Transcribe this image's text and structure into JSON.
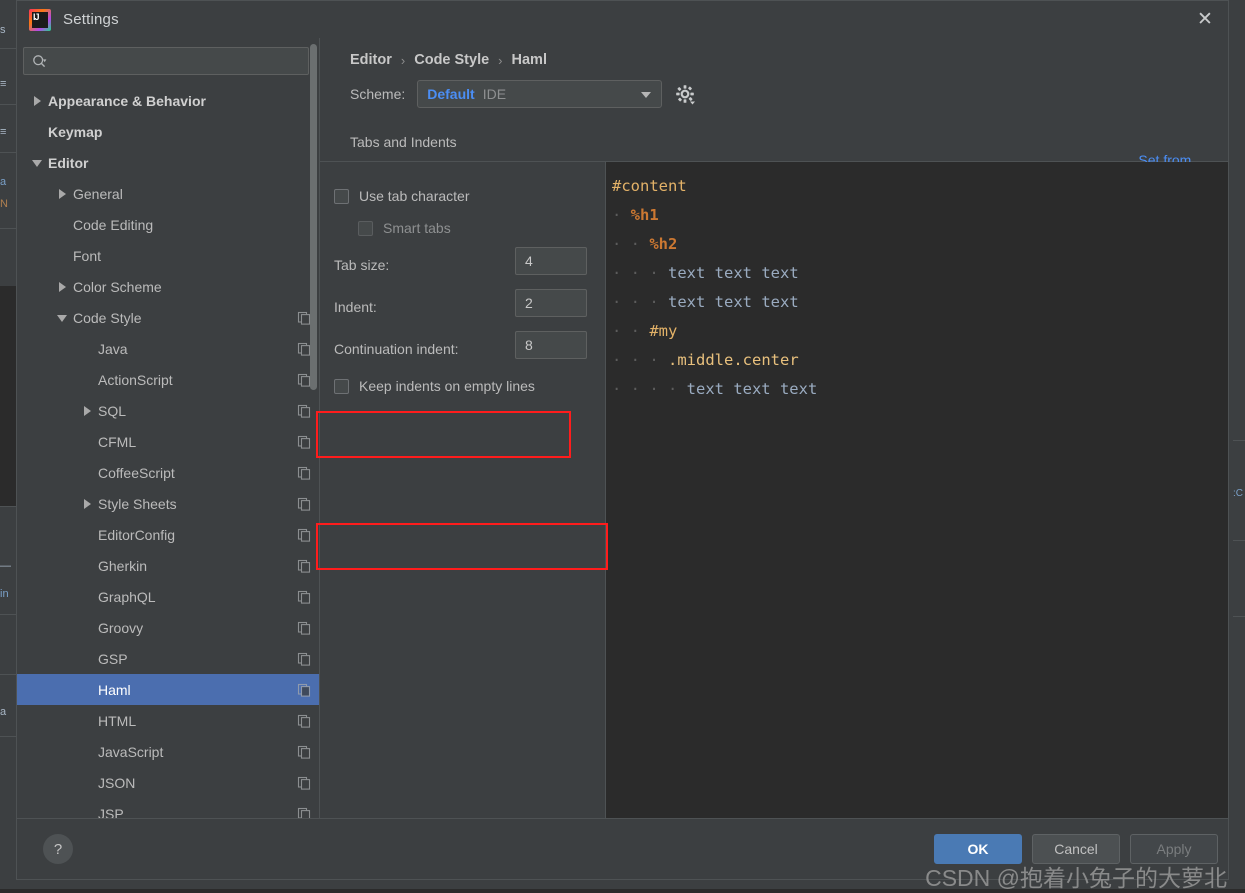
{
  "window": {
    "title": "Settings",
    "logo_text": "IJ",
    "close_label": "✕"
  },
  "search": {
    "value": "",
    "placeholder": "",
    "icon": "search-icon"
  },
  "sidebar": {
    "items": [
      {
        "label": "Appearance & Behavior",
        "indent": 0,
        "twisty": "right",
        "bold": true,
        "copy": false,
        "selected": false
      },
      {
        "label": "Keymap",
        "indent": 0,
        "twisty": "none",
        "bold": true,
        "copy": false,
        "selected": false
      },
      {
        "label": "Editor",
        "indent": 0,
        "twisty": "down",
        "bold": true,
        "copy": false,
        "selected": false
      },
      {
        "label": "General",
        "indent": 1,
        "twisty": "right",
        "bold": false,
        "copy": false,
        "selected": false
      },
      {
        "label": "Code Editing",
        "indent": 1,
        "twisty": "none",
        "bold": false,
        "copy": false,
        "selected": false
      },
      {
        "label": "Font",
        "indent": 1,
        "twisty": "none",
        "bold": false,
        "copy": false,
        "selected": false
      },
      {
        "label": "Color Scheme",
        "indent": 1,
        "twisty": "right",
        "bold": false,
        "copy": false,
        "selected": false
      },
      {
        "label": "Code Style",
        "indent": 1,
        "twisty": "down",
        "bold": false,
        "copy": true,
        "selected": false
      },
      {
        "label": "Java",
        "indent": 2,
        "twisty": "none",
        "bold": false,
        "copy": true,
        "selected": false
      },
      {
        "label": "ActionScript",
        "indent": 2,
        "twisty": "none",
        "bold": false,
        "copy": true,
        "selected": false
      },
      {
        "label": "SQL",
        "indent": 2,
        "twisty": "right",
        "bold": false,
        "copy": true,
        "selected": false
      },
      {
        "label": "CFML",
        "indent": 2,
        "twisty": "none",
        "bold": false,
        "copy": true,
        "selected": false
      },
      {
        "label": "CoffeeScript",
        "indent": 2,
        "twisty": "none",
        "bold": false,
        "copy": true,
        "selected": false
      },
      {
        "label": "Style Sheets",
        "indent": 2,
        "twisty": "right",
        "bold": false,
        "copy": true,
        "selected": false
      },
      {
        "label": "EditorConfig",
        "indent": 2,
        "twisty": "none",
        "bold": false,
        "copy": true,
        "selected": false
      },
      {
        "label": "Gherkin",
        "indent": 2,
        "twisty": "none",
        "bold": false,
        "copy": true,
        "selected": false
      },
      {
        "label": "GraphQL",
        "indent": 2,
        "twisty": "none",
        "bold": false,
        "copy": true,
        "selected": false
      },
      {
        "label": "Groovy",
        "indent": 2,
        "twisty": "none",
        "bold": false,
        "copy": true,
        "selected": false
      },
      {
        "label": "GSP",
        "indent": 2,
        "twisty": "none",
        "bold": false,
        "copy": true,
        "selected": false
      },
      {
        "label": "Haml",
        "indent": 2,
        "twisty": "none",
        "bold": false,
        "copy": true,
        "selected": true
      },
      {
        "label": "HTML",
        "indent": 2,
        "twisty": "none",
        "bold": false,
        "copy": true,
        "selected": false
      },
      {
        "label": "JavaScript",
        "indent": 2,
        "twisty": "none",
        "bold": false,
        "copy": true,
        "selected": false
      },
      {
        "label": "JSON",
        "indent": 2,
        "twisty": "none",
        "bold": false,
        "copy": true,
        "selected": false
      },
      {
        "label": "JSP",
        "indent": 2,
        "twisty": "none",
        "bold": false,
        "copy": true,
        "selected": false
      }
    ],
    "selected_index": 19
  },
  "breadcrumb": {
    "items": [
      "Editor",
      "Code Style",
      "Haml"
    ],
    "separator": "›"
  },
  "scheme": {
    "label": "Scheme:",
    "value": "Default",
    "scope": "IDE",
    "gear_icon": "gear-icon",
    "set_from_label": "Set from..."
  },
  "settings": {
    "section_title": "Tabs and Indents",
    "rows": [
      {
        "type": "checkbox",
        "label": "Use tab character",
        "checked": false,
        "dim": false,
        "name": "use-tab-character"
      },
      {
        "type": "checkbox",
        "label": "Smart tabs",
        "checked": false,
        "dim": true,
        "name": "smart-tabs"
      },
      {
        "type": "field",
        "label": "Tab size:",
        "value": "4",
        "name": "tab-size"
      },
      {
        "type": "field",
        "label": "Indent:",
        "value": "2",
        "name": "indent"
      },
      {
        "type": "field",
        "label": "Continuation indent:",
        "value": "8",
        "name": "continuation-indent"
      },
      {
        "type": "checkbox",
        "label": "Keep indents on empty lines",
        "checked": false,
        "dim": false,
        "name": "keep-indents-on-empty-lines"
      }
    ]
  },
  "preview": {
    "lines": [
      {
        "dots": 0,
        "tokens": [
          {
            "t": "#content",
            "c": "id"
          }
        ]
      },
      {
        "dots": 2,
        "tokens": [
          {
            "t": "%h1",
            "c": "tag"
          }
        ]
      },
      {
        "dots": 4,
        "tokens": [
          {
            "t": "%h2",
            "c": "tag"
          }
        ]
      },
      {
        "dots": 6,
        "tokens": [
          {
            "t": "text text text",
            "c": "txt"
          }
        ]
      },
      {
        "dots": 6,
        "tokens": [
          {
            "t": "text text text",
            "c": "txt"
          }
        ]
      },
      {
        "dots": 4,
        "tokens": [
          {
            "t": "#my",
            "c": "id"
          }
        ]
      },
      {
        "dots": 6,
        "tokens": [
          {
            "t": ".middle.center",
            "c": "cls"
          }
        ]
      },
      {
        "dots": 8,
        "tokens": [
          {
            "t": "text text text",
            "c": "txt"
          }
        ]
      }
    ]
  },
  "footer": {
    "help_label": "?",
    "ok_label": "OK",
    "cancel_label": "Cancel",
    "apply_label": "Apply"
  },
  "watermark": "CSDN @抱着小兔子的大萝北",
  "background_strips": {
    "left": [
      "s",
      "≡",
      "≡",
      "a",
      "N",
      "",
      "—",
      "in",
      "",
      "",
      "a",
      "",
      "",
      ""
    ],
    "right": [
      ":C"
    ]
  },
  "colors": {
    "accent": "#4b8ef5",
    "selection": "#4b6eaf",
    "annotation": "#ff1c1c",
    "panel": "#3c3f41",
    "editor_bg": "#2b2b2b",
    "primary_button": "#4a7ab4",
    "token_id": "#e3b268",
    "token_tag": "#cc7832",
    "token_text": "#9aabc0",
    "token_class": "#e8c07d"
  }
}
